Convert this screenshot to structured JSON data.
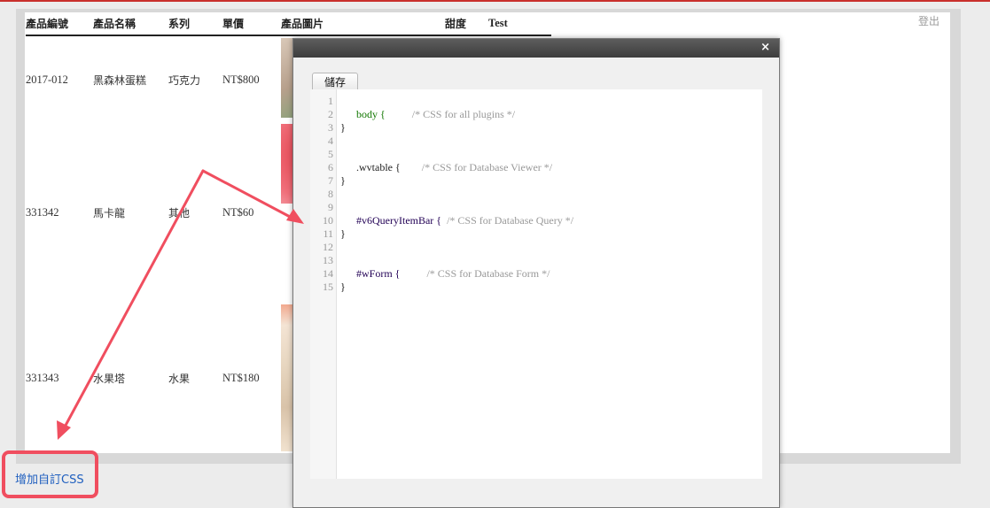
{
  "header": {
    "logout_label": "登出"
  },
  "table": {
    "columns": [
      "產品編號",
      "產品名稱",
      "系列",
      "單價",
      "產品圖片",
      "甜度",
      "Test"
    ],
    "rows": [
      {
        "id": "2017-012",
        "name": "黑森林蛋糕",
        "series": "巧克力",
        "price": "NT$800"
      },
      {
        "id": "331342",
        "name": "馬卡龍",
        "series": "其他",
        "price": "NT$60"
      },
      {
        "id": "331343",
        "name": "水果塔",
        "series": "水果",
        "price": "NT$180"
      }
    ]
  },
  "modal": {
    "close_label": "×",
    "save_label": "儲存",
    "line_numbers": [
      "1",
      "2",
      "3",
      "4",
      "5",
      "6",
      "7",
      "8",
      "9",
      "10",
      "11",
      "12",
      "13",
      "14",
      "15"
    ],
    "lines": [
      {
        "selector": "body {",
        "comment": "/* CSS for all plugins */"
      },
      {
        "text": "}"
      },
      {
        "selector": ".wvtable {",
        "comment": "/* CSS for Database Viewer */"
      },
      {
        "text": "}"
      },
      {
        "selector": "#v6QueryItemBar {",
        "comment": "/* CSS for Database Query */"
      },
      {
        "text": "}"
      },
      {
        "selector": "#wForm {",
        "comment": "/* CSS for Database Form */"
      },
      {
        "text": "}"
      }
    ]
  },
  "add_css_label": "增加自訂CSS",
  "colors": {
    "highlight": "#f04e5f",
    "link": "#1f5fbf",
    "top_line": "#c9302c"
  }
}
